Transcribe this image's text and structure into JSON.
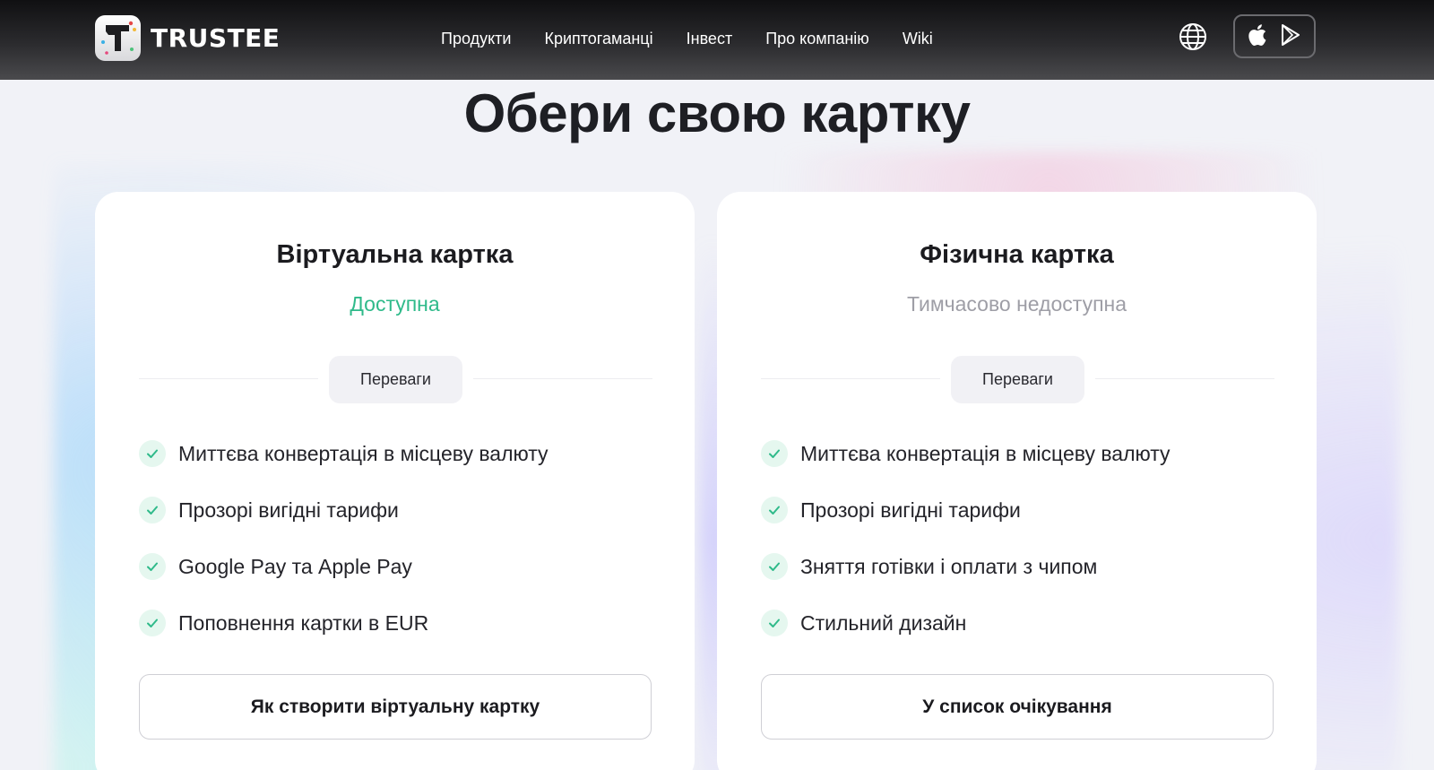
{
  "header": {
    "brand": "TRUSTEE",
    "nav": [
      "Продукти",
      "Криптогаманці",
      "Інвест",
      "Про компанію",
      "Wiki"
    ]
  },
  "headline": "Обери свою картку",
  "cards": [
    {
      "title": "Віртуальна картка",
      "status": "Доступна",
      "badge": "Переваги",
      "features": [
        "Миттєва конвертація в місцеву валюту",
        "Прозорі вигідні тарифи",
        "Google Pay та Apple Pay",
        "Поповнення картки в EUR"
      ],
      "cta": "Як створити віртуальну картку"
    },
    {
      "title": "Фізична картка",
      "status": "Тимчасово недоступна",
      "badge": "Переваги",
      "features": [
        "Миттєва конвертація в місцеву валюту",
        "Прозорі вигідні тарифи",
        "Зняття готівки і оплати з чипом",
        "Стильний дизайн"
      ],
      "cta": "У список очікування"
    }
  ],
  "colors": {
    "available": "#2fba8a",
    "unavailable": "#9e9ea6",
    "check_bg": "#e5f7ef",
    "check": "#2fba8a"
  },
  "icons": {
    "language": "globe-icon",
    "app_store": "apple-icon",
    "play_store": "google-play-icon",
    "feature": "check-icon"
  }
}
